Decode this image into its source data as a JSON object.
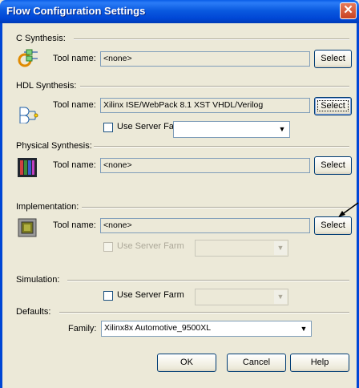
{
  "window": {
    "title": "Flow Configuration Settings",
    "close_glyph": "✕"
  },
  "sections": {
    "c_synthesis": {
      "label": "C Synthesis:",
      "tool_label": "Tool name:",
      "tool_value": "<none>",
      "select_label": "Select",
      "icon": "c-synthesis-icon"
    },
    "hdl_synthesis": {
      "label": "HDL Synthesis:",
      "tool_label": "Tool name:",
      "tool_value": "Xilinx ISE/WebPack 8.1 XST VHDL/Verilog",
      "select_label": "Select",
      "server_farm_label": "Use Server Farm",
      "server_farm_value": "",
      "icon": "logic-gates-icon"
    },
    "physical_synthesis": {
      "label": "Physical Synthesis:",
      "tool_label": "Tool name:",
      "tool_value": "<none>",
      "select_label": "Select",
      "icon": "fpga-layout-icon"
    },
    "implementation": {
      "label": "Implementation:",
      "tool_label": "Tool name:",
      "tool_value": "<none>",
      "select_label": "Select",
      "server_farm_label": "Use Server Farm",
      "server_farm_value": "",
      "icon": "chip-icon"
    },
    "simulation": {
      "label": "Simulation:",
      "server_farm_label": "Use Server Farm",
      "server_farm_value": ""
    },
    "defaults": {
      "label": "Defaults:",
      "family_label": "Family:",
      "family_value": "Xilinx8x Automotive_9500XL"
    }
  },
  "buttons": {
    "ok": "OK",
    "cancel": "Cancel",
    "help": "Help"
  },
  "colors": {
    "titlebar": "#0046d5",
    "dialog_bg": "#ece9d8",
    "close": "#c94221"
  }
}
